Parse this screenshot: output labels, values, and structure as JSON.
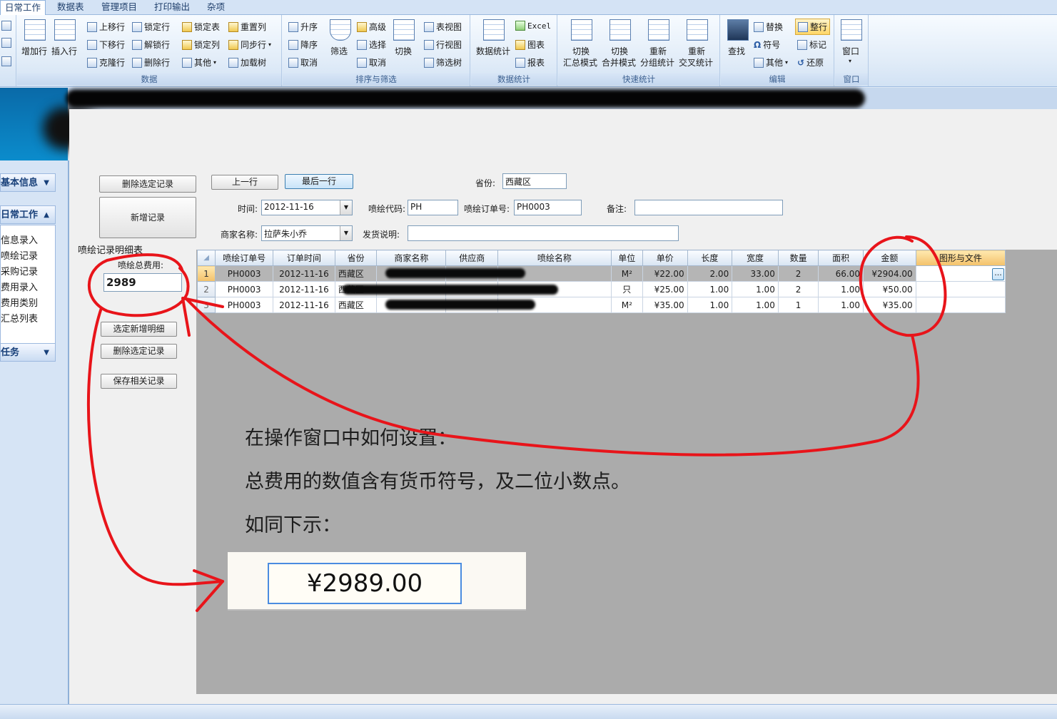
{
  "tabs": [
    "日常工作",
    "数据表",
    "管理项目",
    "打印输出",
    "杂项"
  ],
  "ribbon": {
    "groups": [
      "数据",
      "排序与筛选",
      "数据统计",
      "快速统计",
      "编辑",
      "窗口"
    ],
    "data_group": {
      "add_row": "增加行",
      "insert_row": "插入行",
      "move_up": "上移行",
      "move_down": "下移行",
      "clone_row": "克隆行",
      "lock_row": "锁定行",
      "unlock_row": "解锁行",
      "delete_row": "删除行",
      "lock_table": "锁定表",
      "lock_col": "锁定列",
      "other": "其他",
      "rearrange_col": "重置列",
      "sync_row": "同步行",
      "load_tree": "加载树"
    },
    "sort_group": {
      "asc": "升序",
      "desc": "降序",
      "cancel1": "取消",
      "filter": "筛选",
      "advanced": "高级",
      "select": "选择",
      "cancel2": "取消",
      "toggle": "切换",
      "table_view": "表视图",
      "row_view": "行视图",
      "filter_tree": "筛选树"
    },
    "stats_group": {
      "data_stats": "数据统计",
      "excel": "Excel",
      "chart": "图表",
      "report": "报表"
    },
    "quick_group": {
      "b1a": "切换",
      "b1b": "汇总模式",
      "b2a": "切换",
      "b2b": "合并模式",
      "b3a": "重新",
      "b3b": "分组统计",
      "b4a": "重新",
      "b4b": "交叉统计"
    },
    "edit_group": {
      "find": "查找",
      "replace": "替换",
      "symbol": "符号",
      "other": "其他",
      "wrap": "整行",
      "mark": "标记",
      "restore": "还原"
    },
    "window_group": {
      "window": "窗口"
    }
  },
  "nav": {
    "sections": [
      "基本信息",
      "日常工作",
      "任务"
    ],
    "items": [
      "信息录入",
      "喷绘记录",
      "采购记录",
      "费用录入",
      "费用类别",
      "汇总列表"
    ]
  },
  "form": {
    "btn_delete_top": "删除选定记录",
    "btn_new": "新增记录",
    "btn_prev": "上一行",
    "btn_last": "最后一行",
    "province_label": "省份:",
    "province_value": "西藏区",
    "time_label": "时间:",
    "time_value": "2012-11-16",
    "code_label": "喷绘代码:",
    "code_value": "PH",
    "order_label": "喷绘订单号:",
    "order_value": "PH0003",
    "remark_label": "备注:",
    "remark_value": "",
    "merchant_label": "商家名称:",
    "merchant_value": "拉萨朱小乔",
    "ship_label": "发货说明:",
    "ship_value": "",
    "detail_title": "喷绘记录明细表",
    "total_label": "喷绘总费用:",
    "total_value": "2989",
    "btn_add_detail": "选定新增明细",
    "btn_delete_sel": "删除选定记录",
    "btn_save": "保存相关记录"
  },
  "grid": {
    "columns": [
      "喷绘订单号",
      "订单时间",
      "省份",
      "商家名称",
      "供应商",
      "喷绘名称",
      "单位",
      "单价",
      "长度",
      "宽度",
      "数量",
      "面积",
      "金额",
      "图形与文件"
    ],
    "rows": [
      {
        "n": "1",
        "order": "PH0003",
        "date": "2012-11-16",
        "prov": "西藏区",
        "unit": "M²",
        "price": "¥22.00",
        "len": "2.00",
        "wid": "33.00",
        "qty": "2",
        "area": "66.00",
        "amount": "¥2904.00"
      },
      {
        "n": "2",
        "order": "PH0003",
        "date": "2012-11-16",
        "prov": "西藏区",
        "unit": "只",
        "price": "¥25.00",
        "len": "1.00",
        "wid": "1.00",
        "qty": "2",
        "area": "1.00",
        "amount": "¥50.00"
      },
      {
        "n": "3",
        "order": "PH0003",
        "date": "2012-11-16",
        "prov": "西藏区",
        "unit": "M²",
        "price": "¥35.00",
        "len": "1.00",
        "wid": "1.00",
        "qty": "1",
        "area": "1.00",
        "amount": "¥35.00"
      }
    ],
    "ellipsis": "..."
  },
  "annotation": {
    "line1": "在操作窗口中如何设置：",
    "line2": "总费用的数值含有货币符号，及二位小数点。",
    "line3": "如同下示：",
    "sample_value": "¥2989.00"
  },
  "colors": {
    "annotation_red": "#e8141a",
    "selected_col": "#f3c16a"
  }
}
